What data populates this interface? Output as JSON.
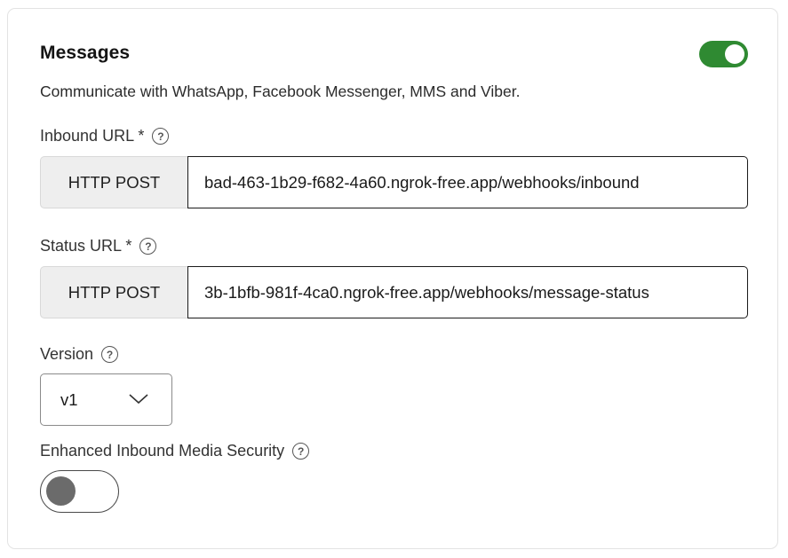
{
  "messages": {
    "title": "Messages",
    "description": "Communicate with WhatsApp, Facebook Messenger, MMS and Viber.",
    "enabled": true,
    "accent_color": "#2f8a32"
  },
  "inbound": {
    "label": "Inbound URL *",
    "help": "?",
    "method": "HTTP POST",
    "value": "bad-463-1b29-f682-4a60.ngrok-free.app/webhooks/inbound"
  },
  "status": {
    "label": "Status URL *",
    "help": "?",
    "method": "HTTP POST",
    "value": "3b-1bfb-981f-4ca0.ngrok-free.app/webhooks/message-status"
  },
  "version": {
    "label": "Version",
    "help": "?",
    "selected": "v1",
    "icon": "chevron-down-icon"
  },
  "media_security": {
    "label": "Enhanced Inbound Media Security",
    "help": "?",
    "enabled": false
  }
}
